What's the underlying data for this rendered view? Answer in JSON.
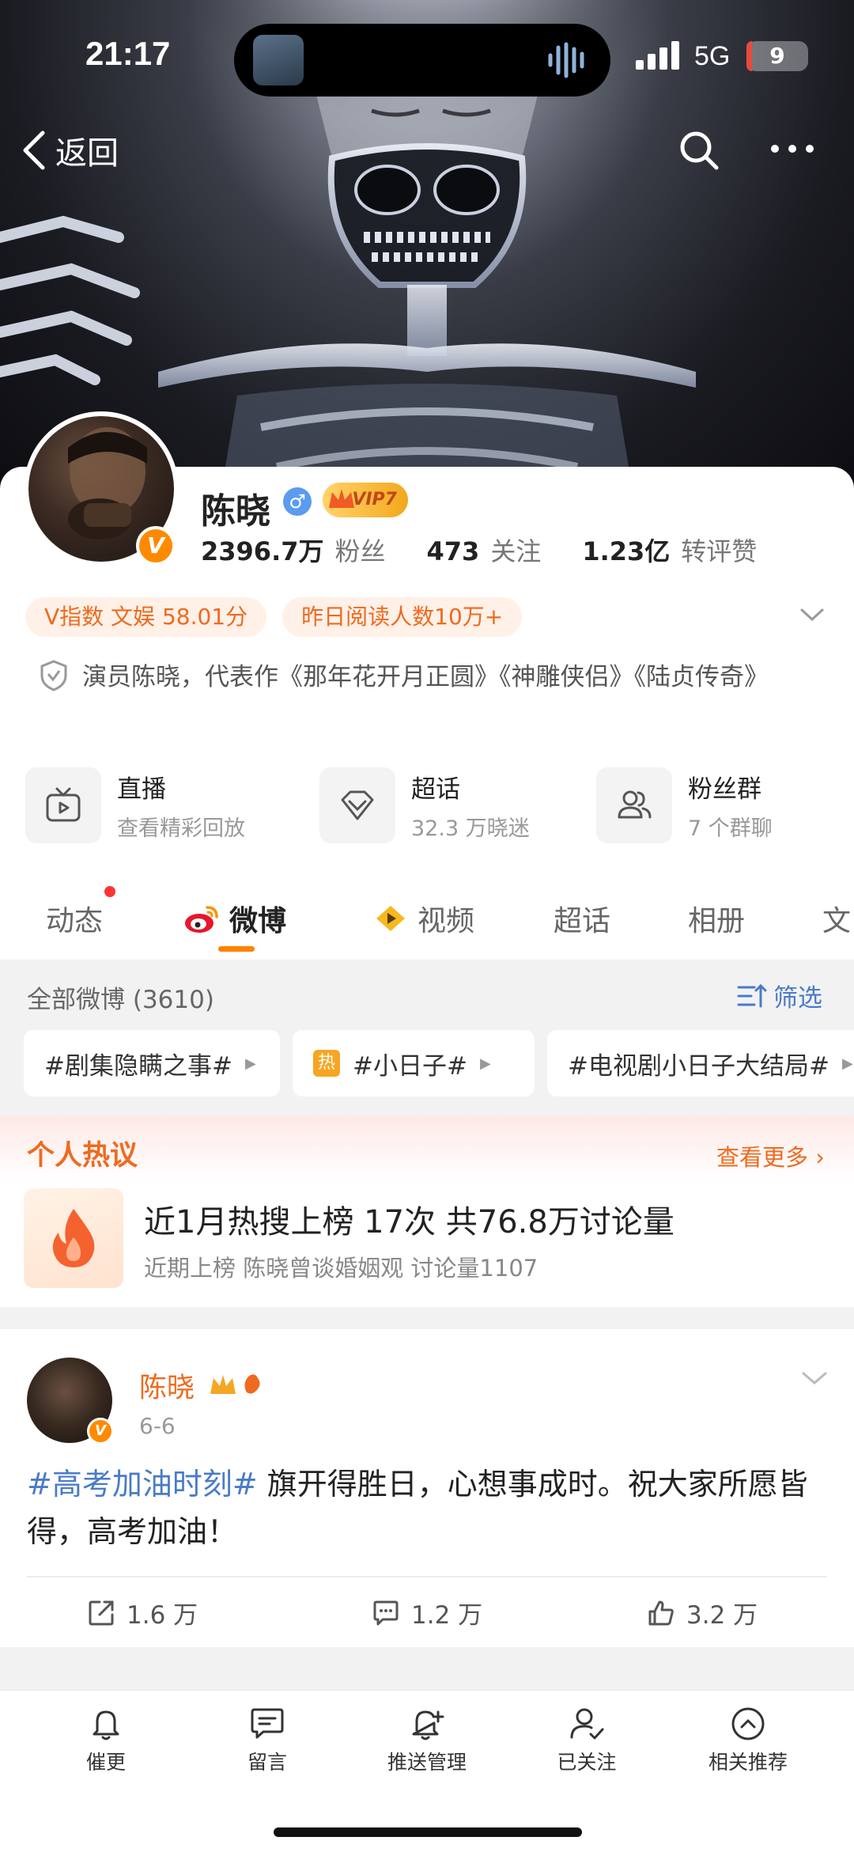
{
  "status_bar": {
    "time": "21:17",
    "network": "5G",
    "battery": "9",
    "battery_level_percent": 9
  },
  "nav": {
    "back_label": "返回"
  },
  "profile": {
    "name": "陈晓",
    "gender": "♂",
    "vip_label": "VIP7",
    "verified_badge": "V",
    "stats": [
      {
        "value": "2396.7万",
        "label": "粉丝"
      },
      {
        "value": "473",
        "label": "关注"
      },
      {
        "value": "1.23亿",
        "label": "转评赞"
      }
    ],
    "badges": [
      "V指数 文娱 58.01分",
      "昨日阅读人数10万+"
    ],
    "bio": "演员陈晓，代表作《那年花开月正圆》《神雕侠侣》《陆贞传奇》"
  },
  "features": [
    {
      "title": "直播",
      "subtitle": "查看精彩回放",
      "icon": "tv-icon"
    },
    {
      "title": "超话",
      "subtitle": "32.3 万晓迷",
      "icon": "diamond-icon"
    },
    {
      "title": "粉丝群",
      "subtitle": "7 个群聊",
      "icon": "group-icon"
    }
  ],
  "tabs": [
    "动态",
    "微博",
    "视频",
    "超话",
    "相册",
    "文"
  ],
  "feed": {
    "header": "全部微博 (3610)",
    "filter_label": "筛选",
    "chips": [
      {
        "label": "#剧集隐瞒之事#",
        "hot": false
      },
      {
        "label": "#小日子#",
        "hot": true,
        "hot_label": "热"
      },
      {
        "label": "#电视剧小日子大结局#",
        "hot": false
      }
    ]
  },
  "hot": {
    "title": "个人热议",
    "more_label": "查看更多 ›",
    "main": "近1月热搜上榜 17次 共76.8万讨论量",
    "sub": "近期上榜 陈晓曾谈婚姻观 讨论量1107"
  },
  "post": {
    "author": "陈晓",
    "date": "6-6",
    "topic": "#高考加油时刻#",
    "text": " 旗开得胜日，心想事成时。祝大家所愿皆得，高考加油！",
    "reposts": "1.6 万",
    "comments": "1.2 万",
    "likes": "3.2 万"
  },
  "bottom_bar": [
    "催更",
    "留言",
    "推送管理",
    "已关注",
    "相关推荐"
  ],
  "colors": {
    "accent": "#ff8200",
    "link": "#4a7bc7",
    "hot_orange": "#ef6a1f"
  }
}
